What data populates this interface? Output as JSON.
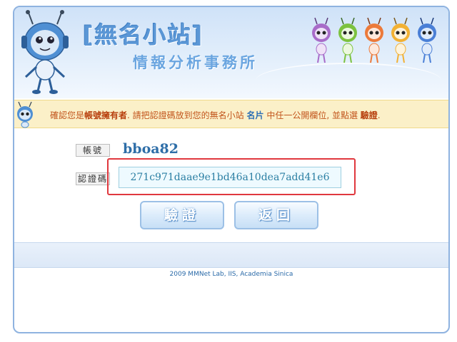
{
  "header": {
    "site_title": "[無名小站]",
    "site_subtitle": "情報分析事務所"
  },
  "notice": {
    "part1": "確認您是",
    "owner": "帳號擁有者",
    "part2": ". 請把認證碼放到您的無名小站 ",
    "card": "名片",
    "part3": " 中任一公開欄位, 並點選 ",
    "verify": "驗證",
    "part4": "."
  },
  "form": {
    "account_label": "帳號",
    "account_value": "bboa82",
    "code_label": "認證碼",
    "code_value": "271c971daae9e1bd46a10dea7add41e6"
  },
  "buttons": {
    "verify_label": "驗證",
    "back_label": "返回"
  },
  "footer": {
    "text": "2009 MMNet Lab, IIS, Academia Sinica"
  },
  "colors": {
    "accent_blue": "#5b97d6",
    "highlight_red": "#e0383e",
    "notice_bg": "#fbf0c8",
    "notice_text": "#c2541b"
  },
  "icons": {
    "mascot": "robot-mascot-icon",
    "mini_mascots": "colored-robot-mascots-icon",
    "notice_icon": "robot-head-icon"
  }
}
